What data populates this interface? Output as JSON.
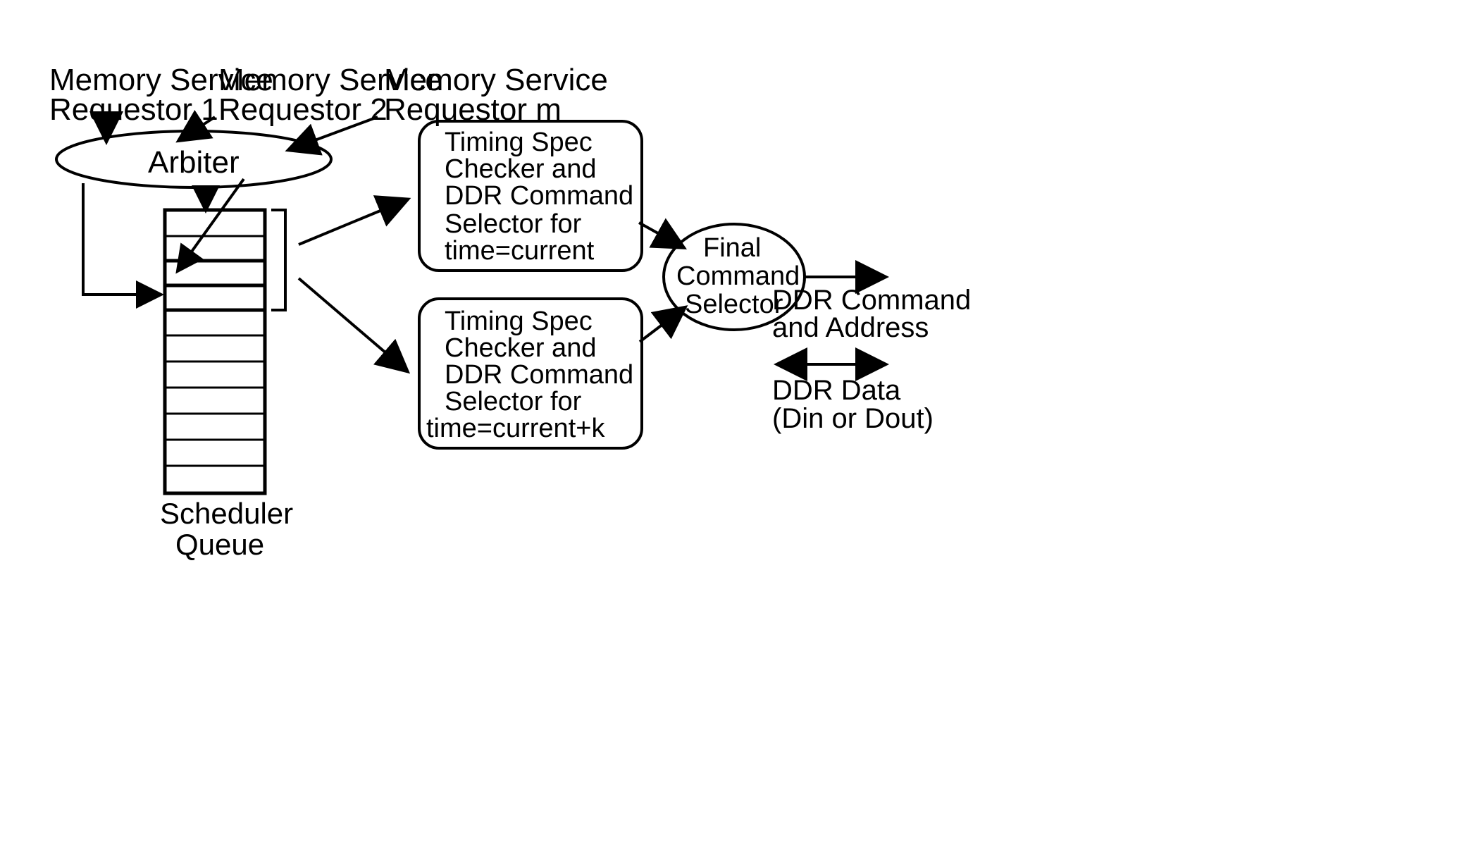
{
  "labels": {
    "requestor1_line1": "Memory Service",
    "requestor1_line2": "Requestor 1",
    "requestor2_line1": "Memory Service",
    "requestor2_line2": "Requestor 2",
    "requestorm_line1": "Memory Service",
    "requestorm_line2": "Requestor m",
    "arbiter": "Arbiter",
    "timing1_line1": "Timing Spec",
    "timing1_line2": "Checker and",
    "timing1_line3": "DDR Command",
    "timing1_line4": "Selector for",
    "timing1_line5": "time=current",
    "timing2_line1": "Timing Spec",
    "timing2_line2": "Checker and",
    "timing2_line3": "DDR Command",
    "timing2_line4": "Selector for",
    "timing2_line5": "time=current+k",
    "final_line1": "Final",
    "final_line2": "Command",
    "final_line3": "Selector",
    "ddr_cmd_line1": "DDR Command",
    "ddr_cmd_line2": "and Address",
    "ddr_data_line1": "DDR Data",
    "ddr_data_line2": "(Din or Dout)",
    "scheduler_line1": "Scheduler",
    "scheduler_line2": "Queue"
  }
}
